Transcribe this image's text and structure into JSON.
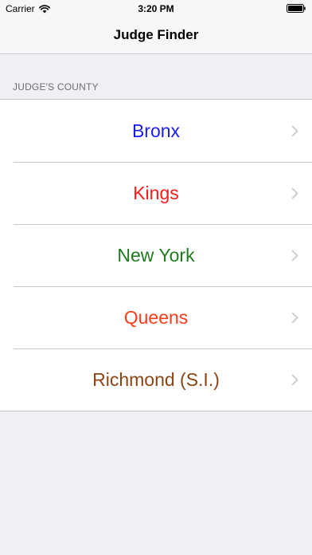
{
  "status_bar": {
    "carrier": "Carrier",
    "time": "3:20 PM",
    "wifi_icon": "wifi-icon",
    "battery_icon": "battery-icon"
  },
  "nav": {
    "title": "Judge Finder"
  },
  "section": {
    "header": "JUDGE'S COUNTY"
  },
  "counties": [
    {
      "label": "Bronx",
      "color": "#1a1aff",
      "icon": "chevron-right-icon"
    },
    {
      "label": "Kings",
      "color": "#ff1a1a",
      "icon": "chevron-right-icon"
    },
    {
      "label": "New York",
      "color": "#1f7a1f",
      "icon": "chevron-right-icon"
    },
    {
      "label": "Queens",
      "color": "#ff3c1a",
      "icon": "chevron-right-icon"
    },
    {
      "label": "Richmond (S.I.)",
      "color": "#8b4513",
      "icon": "chevron-right-icon"
    }
  ],
  "colors": {
    "background": "#efeff4",
    "separator": "#c8c7cc",
    "section_header_text": "#6d6d72",
    "chevron": "#c7c7cc"
  }
}
